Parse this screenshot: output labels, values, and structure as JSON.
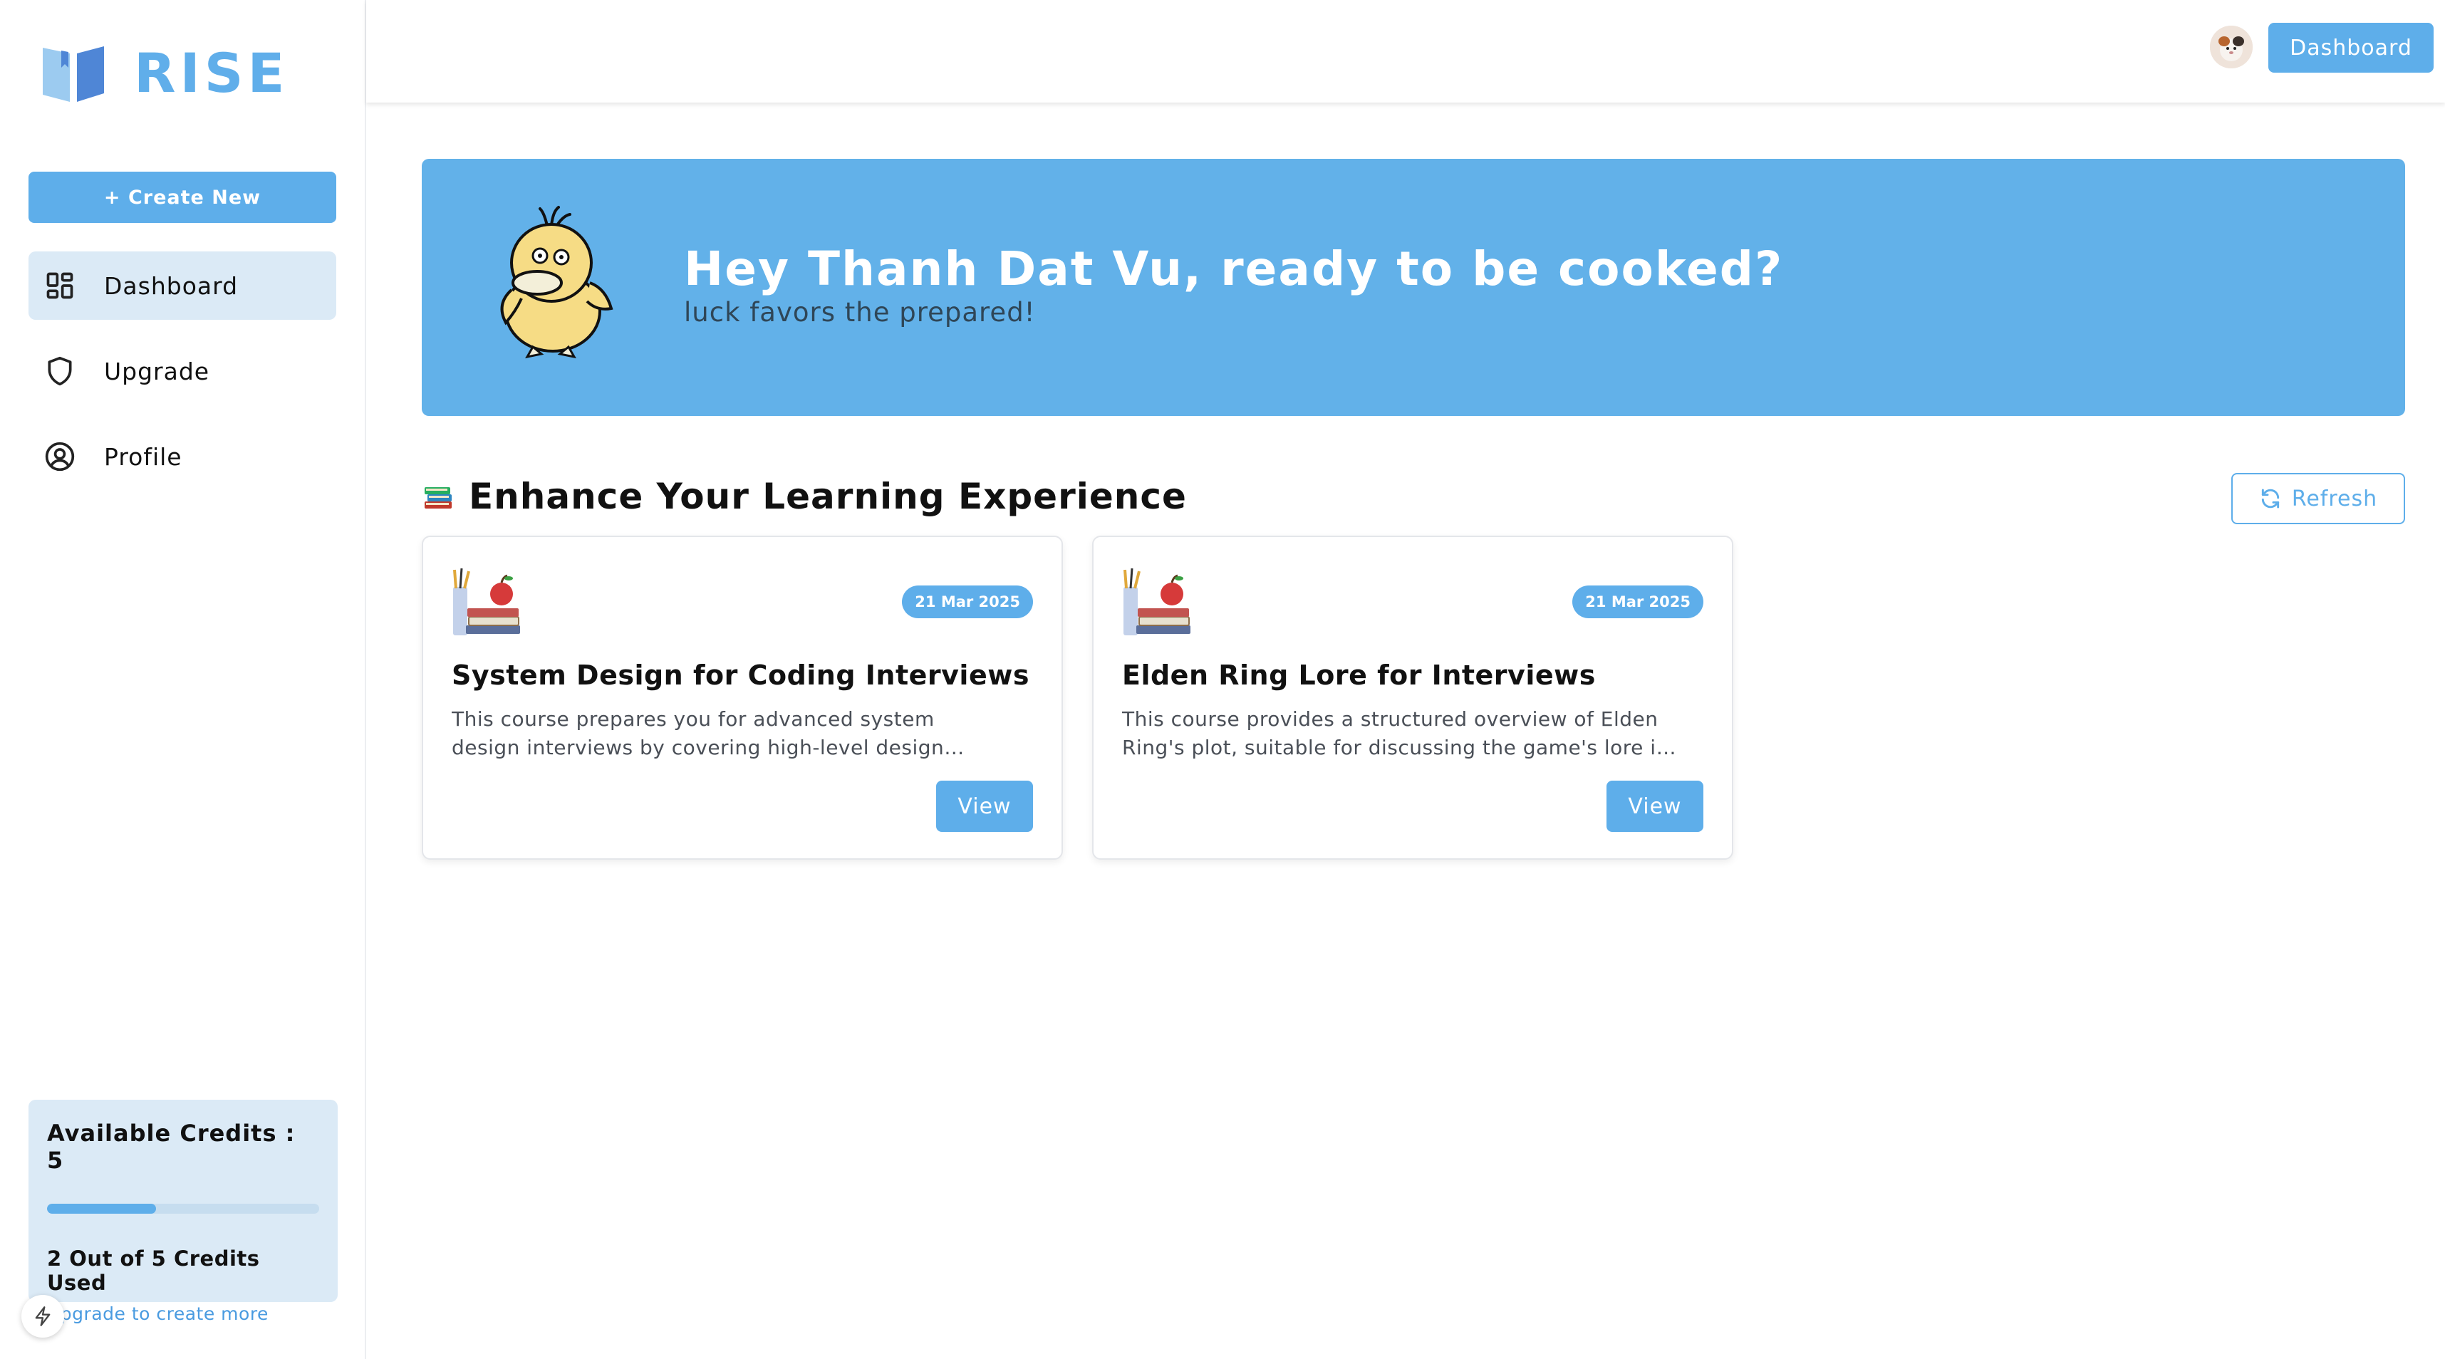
{
  "sidebar": {
    "logo_text": "RISE",
    "create_button": "+ Create New",
    "nav": [
      {
        "label": "Dashboard",
        "icon": "layout-grid-icon",
        "active": true
      },
      {
        "label": "Upgrade",
        "icon": "shield-icon",
        "active": false
      },
      {
        "label": "Profile",
        "icon": "user-circle-icon",
        "active": false
      }
    ],
    "credits": {
      "title": "Available Credits : 5",
      "used_fraction": 0.4,
      "used_text": "2 Out of 5 Credits Used",
      "upgrade_link": "Upgrade to create more"
    }
  },
  "header": {
    "dashboard_button": "Dashboard"
  },
  "hero": {
    "title": "Hey Thanh Dat Vu, ready to be cooked?",
    "subtitle": "luck favors the prepared!"
  },
  "section": {
    "title": "Enhance Your Learning Experience",
    "refresh_button": "Refresh"
  },
  "courses": [
    {
      "date": "21 Mar 2025",
      "title": "System Design for Coding Interviews",
      "description": "This course prepares you for advanced system design interviews by covering high-level design concepts, scalability, and real-world architectures.",
      "view_button": "View"
    },
    {
      "date": "21 Mar 2025",
      "title": "Elden Ring Lore for Interviews",
      "description": "This course provides a structured overview of Elden Ring's plot, suitable for discussing the game's lore in interviews and conversations.",
      "view_button": "View"
    }
  ],
  "colors": {
    "accent": "#5eaeea",
    "hero_bg": "#62b1e9",
    "active_nav_bg": "#dbeaf6"
  }
}
